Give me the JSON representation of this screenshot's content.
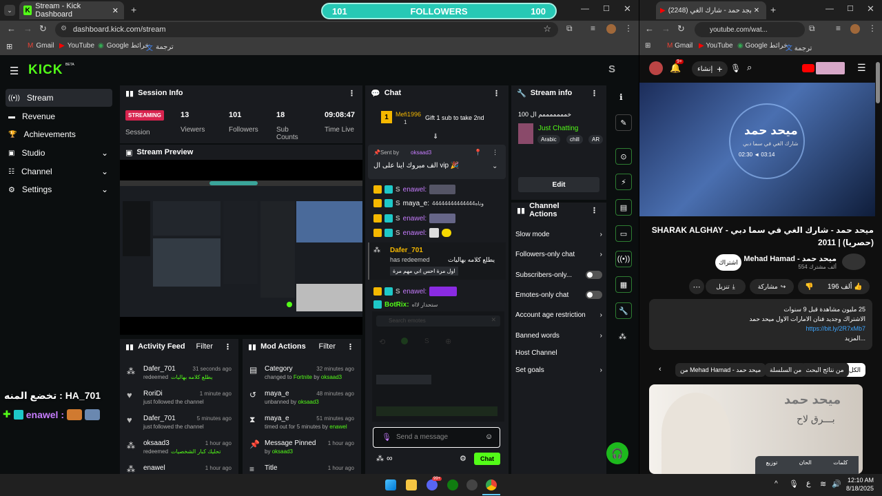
{
  "left_window": {
    "tab_title": "Stream - Kick Dashboard",
    "url": "dashboard.kick.com/stream",
    "bookmarks": [
      "Gmail",
      "YouTube",
      "Google خرائط",
      "ترجمة"
    ]
  },
  "overlay": {
    "left": "101",
    "label": "FOLLOWERS",
    "right": "100"
  },
  "sidebar": {
    "logo": "KICK",
    "logo_beta": "BETA",
    "avatar_letter": "S",
    "items": [
      {
        "label": "Stream"
      },
      {
        "label": "Revenue"
      },
      {
        "label": "Achievements"
      },
      {
        "label": "Studio"
      },
      {
        "label": "Channel"
      },
      {
        "label": "Settings"
      }
    ]
  },
  "session": {
    "title": "Session Info",
    "badge": "STREAMING",
    "badge_label": "Session",
    "stats": [
      {
        "value": "13",
        "label": "Viewers"
      },
      {
        "value": "101",
        "label": "Followers"
      },
      {
        "value": "18",
        "label": "Sub Counts"
      },
      {
        "value": "09:08:47",
        "label": "Time Live"
      }
    ]
  },
  "preview": {
    "title": "Stream Preview"
  },
  "activity": {
    "title": "Activity Feed",
    "filter": "Filter",
    "rows": [
      {
        "name": "Dafer_701",
        "time": "31 seconds ago",
        "sub1": "redeemed",
        "sub2": "يطلع كلامه بهاليات"
      },
      {
        "name": "RoriDi",
        "time": "1 minute ago",
        "sub1": "just followed the channel",
        "sub2": ""
      },
      {
        "name": "Dafer_701",
        "time": "5 minutes ago",
        "sub1": "just followed the channel",
        "sub2": ""
      },
      {
        "name": "oksaad3",
        "time": "1 hour ago",
        "sub1": "redeemed",
        "sub2": "تحليك كبار الشخصيات"
      },
      {
        "name": "enawel",
        "time": "1 hour ago",
        "sub1": "",
        "sub2": ""
      }
    ]
  },
  "mod": {
    "title": "Mod Actions",
    "filter": "Filter",
    "rows": [
      {
        "name": "Category",
        "time": "32 minutes ago",
        "sub1": "changed to",
        "sub2": "Fortnite",
        "sub3": "by",
        "sub4": "oksaad3"
      },
      {
        "name": "maya_e",
        "time": "48 minutes ago",
        "sub1": "unbanned by",
        "sub2": "oksaad3",
        "sub3": "",
        "sub4": ""
      },
      {
        "name": "maya_e",
        "time": "51 minutes ago",
        "sub1": "timed out for 5 minutes by",
        "sub2": "enawel",
        "sub3": "",
        "sub4": ""
      },
      {
        "name": "Message Pinned",
        "time": "1 hour ago",
        "sub1": "by",
        "sub2": "oksaad3",
        "sub3": "",
        "sub4": ""
      },
      {
        "name": "Title",
        "time": "1 hour ago",
        "sub1": "",
        "sub2": "",
        "sub3": "",
        "sub4": ""
      }
    ]
  },
  "chat": {
    "title": "Chat",
    "gift": {
      "user": "Mefi1996",
      "count": "1",
      "text": "Gift 1 sub to take 2nd"
    },
    "pinned": {
      "sent_by": "Sent by",
      "user": "oksaad3",
      "text": "الف مبروك اينا على ال vip 🎉"
    },
    "messages": [
      {
        "user": "enawel:",
        "text": ""
      },
      {
        "user": "maya_e:",
        "text": "وناه44444444444444"
      },
      {
        "user": "enawel:",
        "text": ""
      },
      {
        "user": "enawel:",
        "text": ""
      }
    ],
    "redeem": {
      "user": "Dafer_701",
      "text": "has redeemed",
      "reward": "يطلع كلامه بهاليات",
      "note": "اول مرة احس اني مهم مرة"
    },
    "messages2": [
      {
        "user": "enawel:",
        "text": ""
      },
      {
        "user": "BotRix:",
        "text": "ستحدار لااه"
      }
    ],
    "emote_search": "Search emotes",
    "input_placeholder": "Send a message",
    "send": "Chat"
  },
  "streaminfo": {
    "title": "Stream info",
    "stream_title": "خمممممممم ال 100",
    "category": "Just Chatting",
    "tags": [
      "Arabic",
      "chill",
      "AR"
    ],
    "edit": "Edit"
  },
  "channel_actions": {
    "title": "Channel Actions",
    "items": [
      {
        "label": "Slow mode"
      },
      {
        "label": "Followers-only chat"
      },
      {
        "label": "Subscribers-only..."
      },
      {
        "label": "Emotes-only chat"
      },
      {
        "label": "Account age restriction"
      },
      {
        "label": "Banned words"
      },
      {
        "label": "Host Channel"
      },
      {
        "label": "Set goals"
      }
    ]
  },
  "stream_overlay": {
    "line1": "تخضع المنه : HA_701",
    "line2": "enawel :"
  },
  "right_window": {
    "tab_title": "(2248) ميجد حمد - شارك الغي",
    "url": "youtube.com/wat...",
    "bookmarks": [
      "Gmail",
      "YouTube",
      "Google خرائط",
      "ترجمة"
    ],
    "create": "إنشاء",
    "notif_count": "9+",
    "video_title": "ميحد حمد - شارك الغي في سما دبي - SHARAK ALGHAY (حصريا) | 2011",
    "thumb_name": "ميحد حمد",
    "thumb_sub": "شارك الغي في سما دبي",
    "thumb_time": "02:30 ◄ 03:14",
    "channel": "Mehad Hamad - ميحد حمد",
    "subs": "554 ألف مشترك",
    "subscribe": "اشتراك",
    "likes": "196 ألف",
    "share": "مشاركة",
    "download": "تنزيل",
    "desc_views": "25 مليون مشاهدة قبل 9 سنوات",
    "desc_line": "الاشتراك وجديد فنان الامارات الاول ميحد حمد",
    "desc_link": "https://bit.ly/2R7xMb7",
    "desc_more": "...المزيد",
    "chips": [
      "الكل",
      "من نتائج البحث",
      "من السلسلة",
      "من Mehad Hamad - ميحد حمد"
    ],
    "rec_title": "ميحد حمد",
    "rec_sub": "بـــرق لاح",
    "credits": [
      "توزيع",
      "الحان",
      "كلمات"
    ]
  },
  "taskbar": {
    "lang": "ع",
    "time": "12:10 AM",
    "date": "8/18/2025",
    "discord_badge": "99+"
  }
}
